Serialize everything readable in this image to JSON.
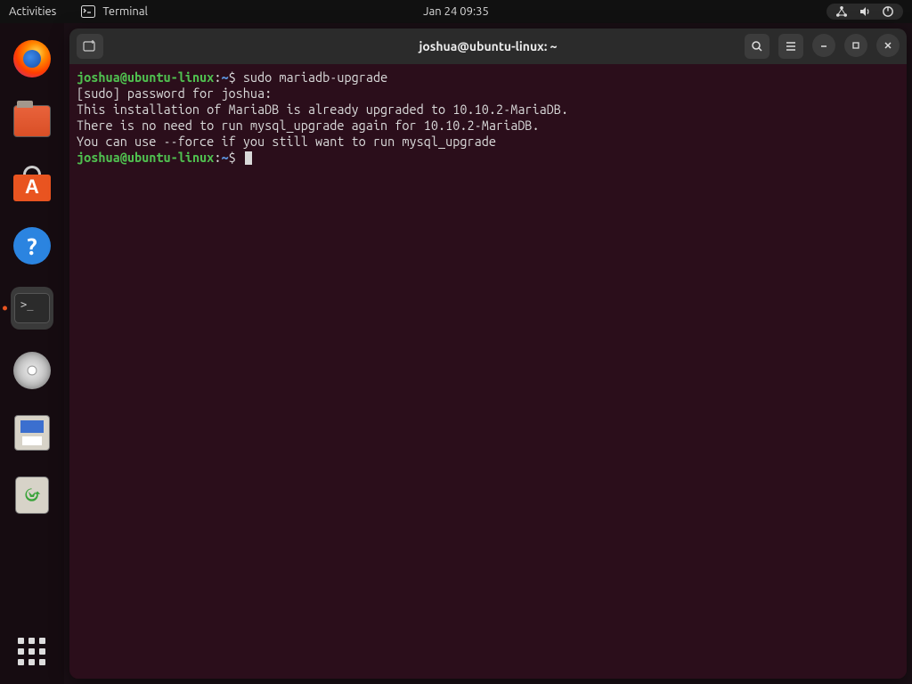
{
  "topbar": {
    "activities": "Activities",
    "app_name": "Terminal",
    "datetime": "Jan 24  09:35"
  },
  "dock": {
    "items": [
      {
        "name": "firefox",
        "label": "Firefox"
      },
      {
        "name": "files",
        "label": "Files"
      },
      {
        "name": "software",
        "label": "Ubuntu Software"
      },
      {
        "name": "help",
        "label": "Help",
        "glyph": "?"
      },
      {
        "name": "terminal",
        "label": "Terminal",
        "glyph": ">_",
        "active": true
      },
      {
        "name": "disk",
        "label": "Disk"
      },
      {
        "name": "save",
        "label": "Text Editor"
      },
      {
        "name": "trash",
        "label": "Trash"
      }
    ]
  },
  "window": {
    "title": "joshua@ubuntu-linux: ~"
  },
  "terminal": {
    "prompt": {
      "user": "joshua",
      "at": "@",
      "host": "ubuntu-linux",
      "colon": ":",
      "path": "~",
      "symbol": "$"
    },
    "lines": [
      {
        "type": "prompt",
        "cmd": "sudo mariadb-upgrade"
      },
      {
        "type": "out",
        "text": "[sudo] password for joshua: "
      },
      {
        "type": "out",
        "text": "This installation of MariaDB is already upgraded to 10.10.2-MariaDB."
      },
      {
        "type": "out",
        "text": "There is no need to run mysql_upgrade again for 10.10.2-MariaDB."
      },
      {
        "type": "out",
        "text": "You can use --force if you still want to run mysql_upgrade"
      },
      {
        "type": "prompt",
        "cmd": "",
        "cursor": true
      }
    ]
  }
}
